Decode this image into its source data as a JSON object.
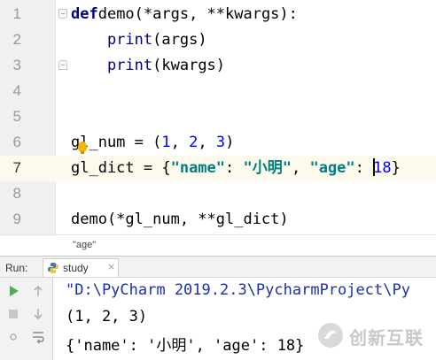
{
  "editor": {
    "lines": [
      {
        "number": "1",
        "tokens": [
          [
            "kw",
            "def"
          ],
          [
            "",
            "demo(*args, **kwargs):"
          ]
        ]
      },
      {
        "number": "2",
        "tokens": [
          [
            "",
            "    "
          ],
          [
            "builtin",
            "print"
          ],
          [
            "",
            "(args)"
          ]
        ]
      },
      {
        "number": "3",
        "tokens": [
          [
            "",
            "    "
          ],
          [
            "builtin",
            "print"
          ],
          [
            "",
            "(kwargs)"
          ]
        ]
      },
      {
        "number": "4",
        "tokens": []
      },
      {
        "number": "5",
        "tokens": []
      },
      {
        "number": "6",
        "tokens": [
          [
            "",
            "gl_num = ("
          ],
          [
            "num",
            "1"
          ],
          [
            "",
            ", "
          ],
          [
            "num",
            "2"
          ],
          [
            "",
            ", "
          ],
          [
            "num",
            "3"
          ],
          [
            "",
            ")"
          ]
        ]
      },
      {
        "number": "7",
        "tokens": [
          [
            "",
            "gl_dict = {"
          ],
          [
            "str",
            "\"name\""
          ],
          [
            "",
            ": "
          ],
          [
            "str",
            "\"小明\""
          ],
          [
            "",
            ", "
          ],
          [
            "str",
            "\"age\""
          ],
          [
            "",
            ": "
          ],
          [
            "caret",
            ""
          ],
          [
            "num",
            "18"
          ],
          [
            "",
            "}"
          ]
        ]
      },
      {
        "number": "8",
        "tokens": []
      },
      {
        "number": "9",
        "tokens": [
          [
            "",
            "demo(*gl_num, **gl_dict)"
          ]
        ]
      }
    ],
    "current_line": "7"
  },
  "breadcrumb": {
    "text": "\"age\""
  },
  "run": {
    "label": "Run:",
    "tab_label": "study",
    "output": [
      "\"D:\\PyCharm 2019.2.3\\PycharmProject\\Py",
      "(1, 2, 3)",
      "{'name': '小明', 'age': 18}"
    ]
  },
  "watermark": {
    "text": "创新互联"
  },
  "colors": {
    "keyword": "#000080",
    "number": "#0000ff",
    "string": "#008080",
    "current_line": "#fcfaed",
    "run_green": "#4caf50"
  }
}
